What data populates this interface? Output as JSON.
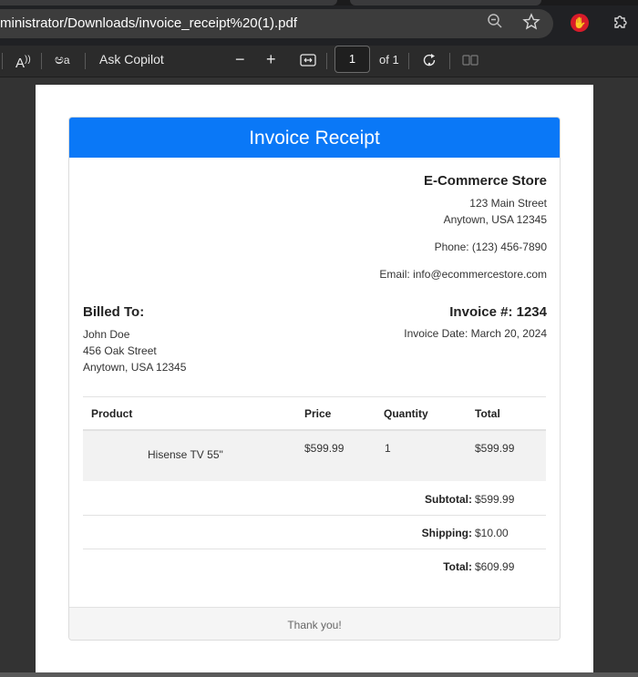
{
  "browser": {
    "url": "ministrator/Downloads/invoice_receipt%20(1).pdf",
    "icons": [
      "zoom-out-icon",
      "star-icon",
      "extension-red-icon",
      "puzzle-icon"
    ]
  },
  "toolbar": {
    "read_aloud_glyph": "A",
    "translate_glyph": "ಅ",
    "ask_copilot": "Ask Copilot",
    "zoom_out_glyph": "−",
    "zoom_in_glyph": "+",
    "fit_glyph": "↔",
    "page_number": "1",
    "page_total": "of 1",
    "rotate_glyph": "⟳",
    "two_page_glyph": "▯▯"
  },
  "invoice": {
    "header": "Invoice Receipt",
    "store": {
      "name": "E-Commerce Store",
      "street": "123 Main Street",
      "city": "Anytown, USA 12345",
      "phone": "Phone: (123) 456-7890",
      "email": "Email: info@ecommercestore.com"
    },
    "billed": {
      "title": "Billed To:",
      "name": "John Doe",
      "street": "456 Oak Street",
      "city": "Anytown, USA 12345"
    },
    "number": "Invoice #: 1234",
    "date": "Invoice Date: March 20, 2024",
    "table": {
      "headers": [
        "Product",
        "Price",
        "Quantity",
        "Total"
      ],
      "rows": [
        {
          "product": "Hisense TV 55\"",
          "price": "$599.99",
          "quantity": "1",
          "total": "$599.99"
        }
      ]
    },
    "summary": {
      "subtotal_label": "Subtotal:",
      "subtotal": "$599.99",
      "shipping_label": "Shipping:",
      "shipping": "$10.00",
      "total_label": "Total:",
      "total": "$609.99"
    },
    "footer": "Thank you!"
  },
  "colors": {
    "header_blue": "#0a78f7",
    "viewer_bg": "#333333",
    "toolbar_bg": "#2b2b2b"
  }
}
